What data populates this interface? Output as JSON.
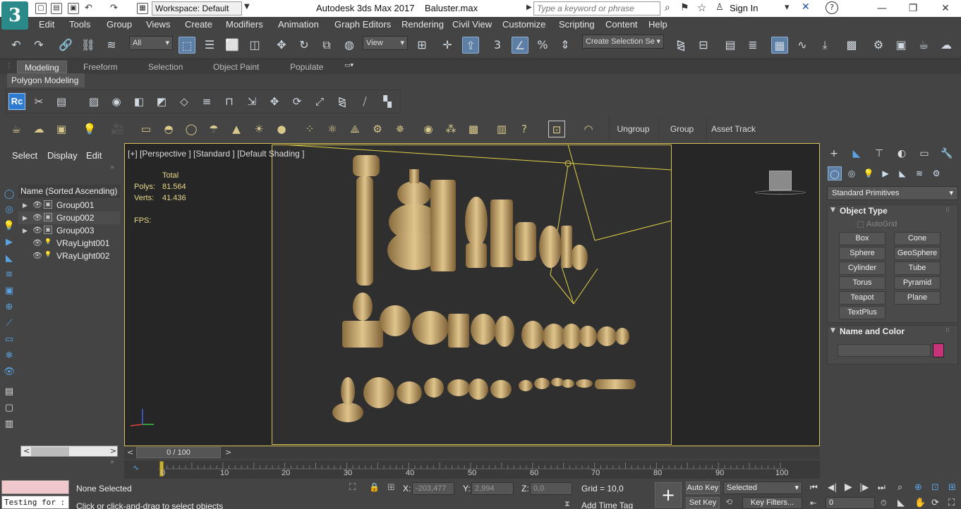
{
  "app": {
    "logo": "3",
    "workspace": "Workspace: Default",
    "title": "Autodesk 3ds Max 2017",
    "filename": "Baluster.max",
    "search_placeholder": "Type a keyword or phrase",
    "signin": "Sign In"
  },
  "menu": [
    "Edit",
    "Tools",
    "Group",
    "Views",
    "Create",
    "Modifiers",
    "Animation",
    "Graph Editors",
    "Rendering",
    "Civil View",
    "Customize",
    "Scripting",
    "Content",
    "Help"
  ],
  "toolbar": {
    "filter_all": "All",
    "view_dropdown": "View",
    "selection_set": "Create Selection Se",
    "snap_label": "3"
  },
  "ribbon": {
    "tabs": [
      "Modeling",
      "Freeform",
      "Selection",
      "Object Paint",
      "Populate"
    ],
    "active_tab": "Modeling",
    "panel": "Polygon Modeling"
  },
  "toolbar3": {
    "buttons": [
      "Ungroup",
      "Group",
      "Asset Track"
    ]
  },
  "scene_explorer": {
    "tabs": [
      "Select",
      "Display",
      "Edit"
    ],
    "header": "Name (Sorted Ascending)",
    "rows": [
      "Group001",
      "Group002",
      "Group003",
      "VRayLight001",
      "VRayLight002"
    ]
  },
  "viewport": {
    "label": "[+] [Perspective ] [Standard ] [Default Shading ]",
    "stats_header": "Total",
    "polys_label": "Polys:",
    "polys_value": "81.564",
    "verts_label": "Verts:",
    "verts_value": "41.436",
    "fps_label": "FPS:"
  },
  "command_panel": {
    "category": "Standard Primitives",
    "object_type_title": "Object Type",
    "autogrid": "AutoGrid",
    "primitives": [
      "Box",
      "Cone",
      "Sphere",
      "GeoSphere",
      "Cylinder",
      "Tube",
      "Torus",
      "Pyramid",
      "Teapot",
      "Plane",
      "TextPlus"
    ],
    "name_color_title": "Name and Color",
    "object_color": "#c8327a"
  },
  "timeline": {
    "frame_display": "0 / 100",
    "ticks": [
      "0",
      "10",
      "20",
      "30",
      "40",
      "50",
      "60",
      "70",
      "80",
      "90",
      "100"
    ]
  },
  "status": {
    "selection": "None Selected",
    "prompt": "Click or click-and-drag to select objects",
    "maxscript": "Testing for :",
    "x_label": "X:",
    "x_value": "-203,477",
    "y_label": "Y:",
    "y_value": "2,994",
    "z_label": "Z:",
    "z_value": "0,0",
    "grid": "Grid = 10,0",
    "add_time_tag": "Add Time Tag",
    "auto_key": "Auto Key",
    "set_key": "Set Key",
    "key_mode": "Selected",
    "key_filters": "Key Filters...",
    "current_frame": "0"
  },
  "colors": {
    "accent": "#5d7fa6",
    "viewport_border": "#d7c25a",
    "baluster": "#c9a86a"
  }
}
